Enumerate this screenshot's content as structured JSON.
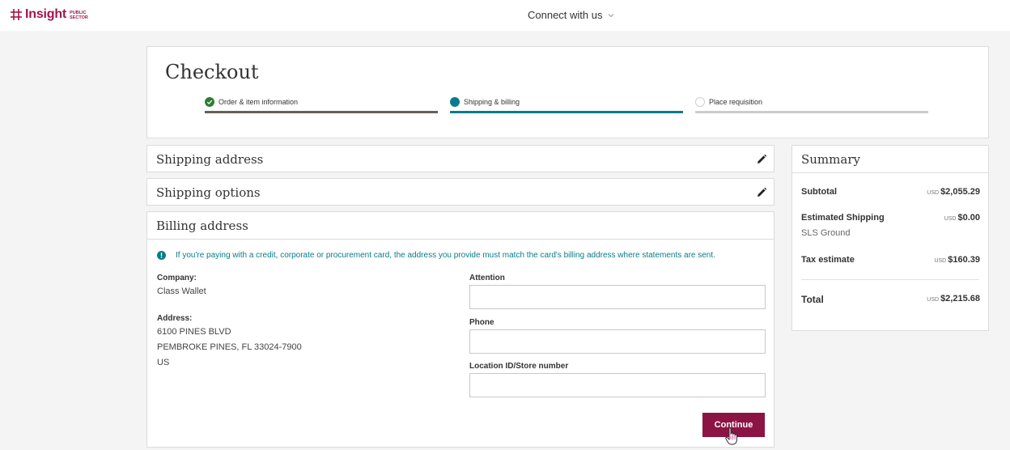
{
  "header": {
    "logo_word": "Insight",
    "logo_sub_1": "PUBLIC",
    "logo_sub_2": "SECTOR",
    "connect_label": "Connect with us"
  },
  "checkout": {
    "title": "Checkout",
    "steps": [
      {
        "label": "Order & item information",
        "status": "complete"
      },
      {
        "label": "Shipping & billing",
        "status": "current"
      },
      {
        "label": "Place requisition",
        "status": "pending"
      }
    ]
  },
  "sections": {
    "shipping_address": "Shipping address",
    "shipping_options": "Shipping options",
    "billing_address": "Billing address"
  },
  "billing": {
    "notice": "If you're paying with a credit, corporate or procurement card, the address you provide must match the card's billing address where statements are sent.",
    "company_label": "Company:",
    "company_value": "Class Wallet",
    "address_label": "Address:",
    "address_line1": "6100 PINES BLVD",
    "address_line2": "PEMBROKE PINES, FL 33024-7900",
    "address_line3": "US",
    "attention_label": "Attention",
    "attention_value": "",
    "phone_label": "Phone",
    "phone_value": "",
    "location_label": "Location ID/Store number",
    "location_value": "",
    "continue_label": "Continue"
  },
  "summary": {
    "title": "Summary",
    "currency": "USD",
    "subtotal_label": "Subtotal",
    "subtotal_value": "$2,055.29",
    "shipping_label": "Estimated Shipping",
    "shipping_method": "SLS Ground",
    "shipping_value": "$0.00",
    "tax_label": "Tax estimate",
    "tax_value": "$160.39",
    "total_label": "Total",
    "total_value": "$2,215.68"
  },
  "colors": {
    "brand": "#a3144e",
    "accent_teal": "#087c8c",
    "complete_green": "#2e7d32",
    "button": "#8c1444"
  }
}
